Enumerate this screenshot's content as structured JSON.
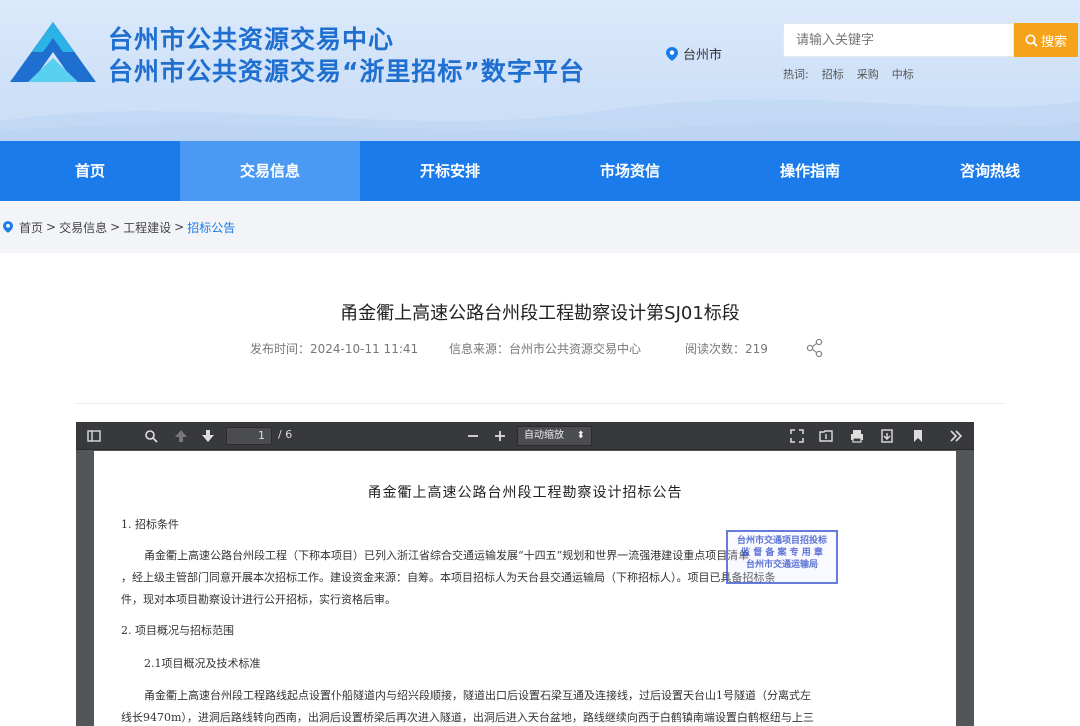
{
  "header": {
    "title_line1": "台州市公共资源交易中心",
    "title_line2": "台州市公共资源交易“浙里招标”数字平台",
    "location": "台州市",
    "search": {
      "placeholder": "请输入关键字",
      "button_label": "搜索"
    },
    "hotwords": {
      "label": "热词:",
      "items": [
        "招标",
        "采购",
        "中标"
      ]
    }
  },
  "nav": {
    "items": [
      {
        "label": "首页",
        "active": false
      },
      {
        "label": "交易信息",
        "active": true
      },
      {
        "label": "开标安排",
        "active": false
      },
      {
        "label": "市场资信",
        "active": false
      },
      {
        "label": "操作指南",
        "active": false
      },
      {
        "label": "咨询热线",
        "active": false
      }
    ]
  },
  "breadcrumb": {
    "items": [
      "首页",
      "交易信息",
      "工程建设",
      "招标公告"
    ],
    "separator": ">"
  },
  "article": {
    "title": "甬金衢上高速公路台州段工程勘察设计第SJ01标段",
    "publish_time": "发布时间：2024-10-11 11:41",
    "source": "信息来源：台州市公共资源交易中心",
    "views": "阅读次数：219"
  },
  "pdf_viewer": {
    "current_page": "1",
    "total_pages": "/ 6",
    "zoom": "自动缩放",
    "document": {
      "title": "甬金衢上高速公路台州段工程勘察设计招标公告",
      "section1_heading": "1.  招标条件",
      "para1_line1": "甬金衢上高速公路台州段工程（下称本项目）已列入浙江省综合交通运输发展“十四五”规划和世界一流强港建设重点项目清单",
      "para1_line2": "，经上级主管部门同意开展本次招标工作。建设资金来源：自筹。本项目招标人为天台县交通运输局（下称招标人）。项目已具备招标条",
      "para1_line3": "件，现对本项目勘察设计进行公开招标，实行资格后审。",
      "section2_heading": "2.  项目概况与招标范围",
      "section2_1_heading": "2.1项目概况及技术标准",
      "para2_line1": "甬金衢上高速台州段工程路线起点设置仆船隧道内与绍兴段顺接，隧道出口后设置石梁互通及连接线，过后设置天台山1号隧道（分离式左",
      "para2_line2": "线长9470m），进洞后路线转向西南，出洞后设置桥梁后再次进入隧道，出洞后进入天台盆地，路线继续向西于白鹤镇南端设置白鹤枢纽与上三",
      "stamp_line1": "台州市交通项目招投标",
      "stamp_line2": "监 督 备 案 专 用 章",
      "stamp_line3": "台州市交通运输局"
    }
  },
  "colors": {
    "brand": "#1b7bea",
    "nav_active": "#4a9af4",
    "search_button": "#f5a31a"
  }
}
